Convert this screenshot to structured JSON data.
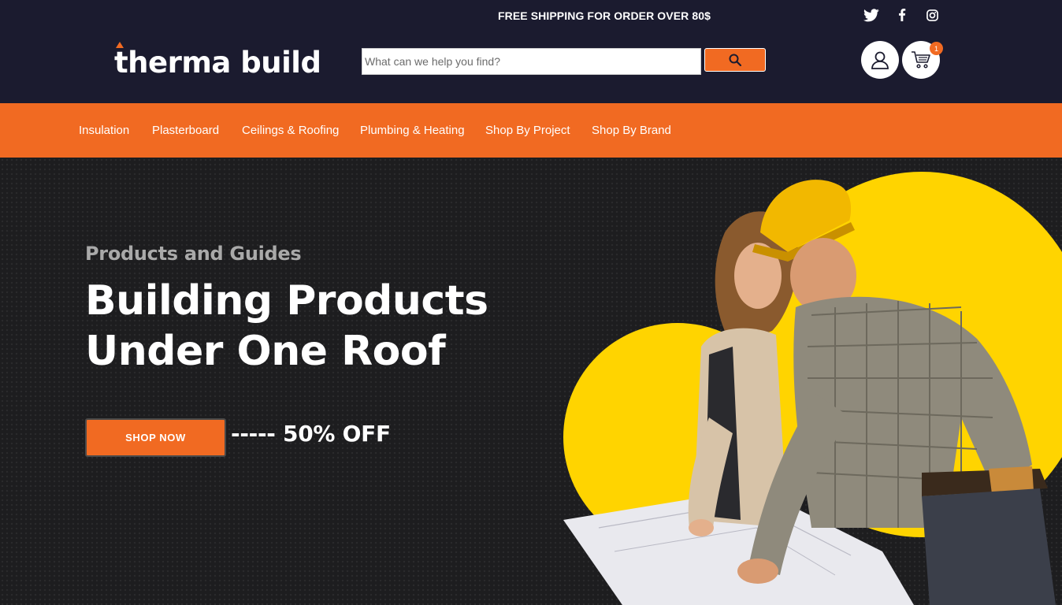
{
  "header": {
    "promo_text": "FREE SHIPPING FOR ORDER OVER 80$",
    "logo_text": "therma build",
    "social": [
      "twitter-icon",
      "facebook-icon",
      "instagram-icon"
    ],
    "search": {
      "placeholder": "What can we help you find?",
      "value": ""
    },
    "cart_count": "1"
  },
  "nav": {
    "items": [
      "Insulation",
      "Plasterboard",
      "Ceilings & Roofing",
      "Plumbing & Heating",
      "Shop By Project",
      "Shop By Brand"
    ]
  },
  "hero": {
    "subtitle": "Products and Guides",
    "title_line1": "Building Products",
    "title_line2": "Under One Roof",
    "cta_label": "SHOP NOW",
    "discount_text": "----- 50% OFF",
    "image_alt": "construction workers reviewing blueprints"
  },
  "colors": {
    "header_bg": "#1b1b2f",
    "accent": "#f16a22",
    "hero_bg": "#1d1d1f",
    "yellow": "#ffd400"
  }
}
